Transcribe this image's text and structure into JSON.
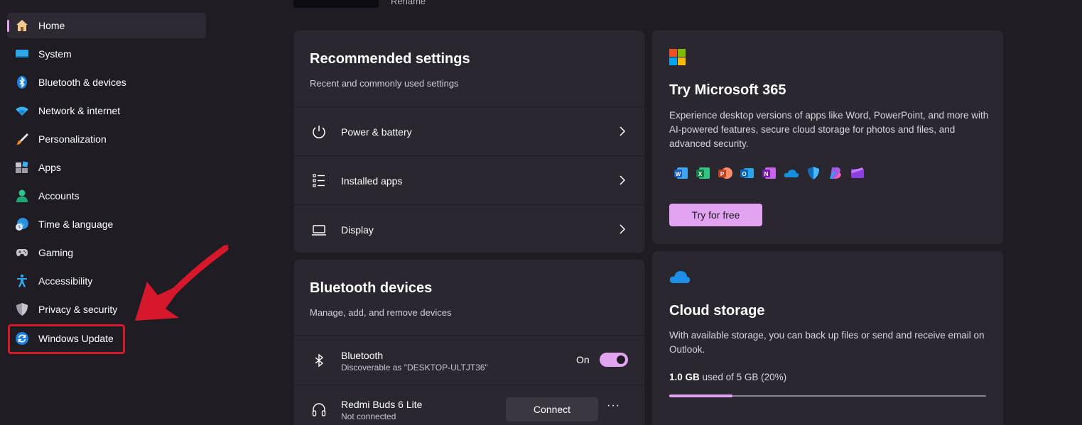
{
  "top": {
    "rename_label": "Rename"
  },
  "sidebar": {
    "items": [
      {
        "label": "Home",
        "icon": "home-icon",
        "active": true
      },
      {
        "label": "System",
        "icon": "system-icon"
      },
      {
        "label": "Bluetooth & devices",
        "icon": "bluetooth-icon"
      },
      {
        "label": "Network & internet",
        "icon": "wifi-icon"
      },
      {
        "label": "Personalization",
        "icon": "brush-icon"
      },
      {
        "label": "Apps",
        "icon": "apps-icon"
      },
      {
        "label": "Accounts",
        "icon": "person-icon"
      },
      {
        "label": "Time & language",
        "icon": "globe-clock-icon"
      },
      {
        "label": "Gaming",
        "icon": "gamepad-icon"
      },
      {
        "label": "Accessibility",
        "icon": "accessibility-icon"
      },
      {
        "label": "Privacy & security",
        "icon": "shield-icon"
      },
      {
        "label": "Windows Update",
        "icon": "update-icon"
      }
    ]
  },
  "recommended": {
    "title": "Recommended settings",
    "subtitle": "Recent and commonly used settings",
    "rows": [
      {
        "label": "Power & battery",
        "icon": "power-icon"
      },
      {
        "label": "Installed apps",
        "icon": "list-icon"
      },
      {
        "label": "Display",
        "icon": "laptop-icon"
      }
    ]
  },
  "bluetooth": {
    "title": "Bluetooth devices",
    "subtitle": "Manage, add, and remove devices",
    "bt_label": "Bluetooth",
    "bt_sub": "Discoverable as \"DESKTOP-ULTJT36\"",
    "bt_state": "On",
    "device_name": "Redmi Buds 6 Lite",
    "device_status": "Not connected",
    "connect_label": "Connect",
    "more_label": "···"
  },
  "m365": {
    "title": "Try Microsoft 365",
    "description": "Experience desktop versions of apps like Word, PowerPoint, and more with AI-powered features, secure cloud storage for photos and files, and advanced security.",
    "button_label": "Try for free",
    "apps": [
      "word-icon",
      "excel-icon",
      "powerpoint-icon",
      "outlook-icon",
      "onenote-icon",
      "onedrive-icon",
      "defender-icon",
      "copilot-icon",
      "clipchamp-icon"
    ]
  },
  "cloud": {
    "title": "Cloud storage",
    "description": "With available storage, you can back up files or send and receive email on Outlook.",
    "used": "1.0 GB",
    "rest": "used of 5 GB (20%)",
    "used_fraction": 0.2
  },
  "colors": {
    "accent": "#e2a4f0",
    "background": "#1f1c24",
    "card": "#2a2730",
    "highlight": "#d5182b"
  }
}
